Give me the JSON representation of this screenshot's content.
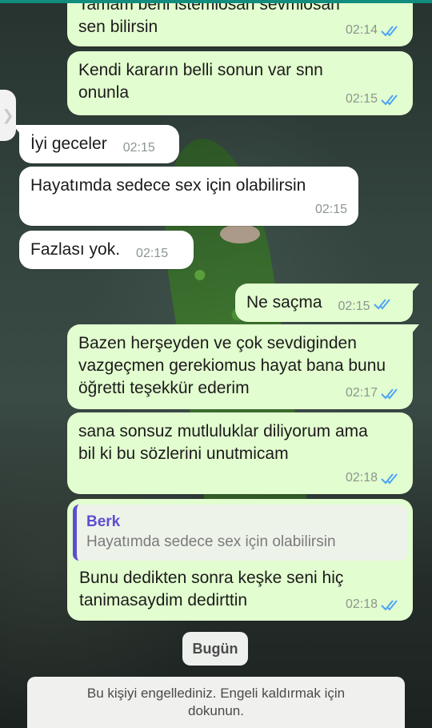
{
  "messages": [
    {
      "text": "Tamam beni istemiosan sevmiosan sen bilirsin",
      "time": "02:14"
    },
    {
      "text": "Kendi kararın belli sonun var snn onunla",
      "time": "02:15"
    },
    {
      "text": "İyi geceler",
      "time": "02:15"
    },
    {
      "text": "Hayatımda sedece sex için olabilirsin",
      "time": "02:15"
    },
    {
      "text": "Fazlası yok.",
      "time": "02:15"
    },
    {
      "text": "Ne saçma",
      "time": "02:15"
    },
    {
      "text": "Bazen herşeyden ve çok sevdiginden vazgeçmen gerekiomus hayat bana bunu öğretti teşekkür ederim",
      "time": "02:17"
    },
    {
      "text": "sana sonsuz mutluluklar diliyorum ama bil ki bu sözlerini unutmicam",
      "time": "02:18"
    },
    {
      "text": "Bunu dedikten sonra keşke seni hiç tanimasaydim dedirttin",
      "time": "02:18",
      "quote": {
        "author": "Berk",
        "text": "Hayatımda sedece sex için olabilirsin"
      }
    }
  ],
  "date_chip": "Bugün",
  "blocked_notice": "Bu kişiyi engellediniz. Engeli kaldırmak için dokunun.",
  "colors": {
    "outgoing": "#e2fdcf",
    "incoming": "#ffffff",
    "read_ticks": "#4fa3f7",
    "quote_author": "#5b4fcf"
  }
}
